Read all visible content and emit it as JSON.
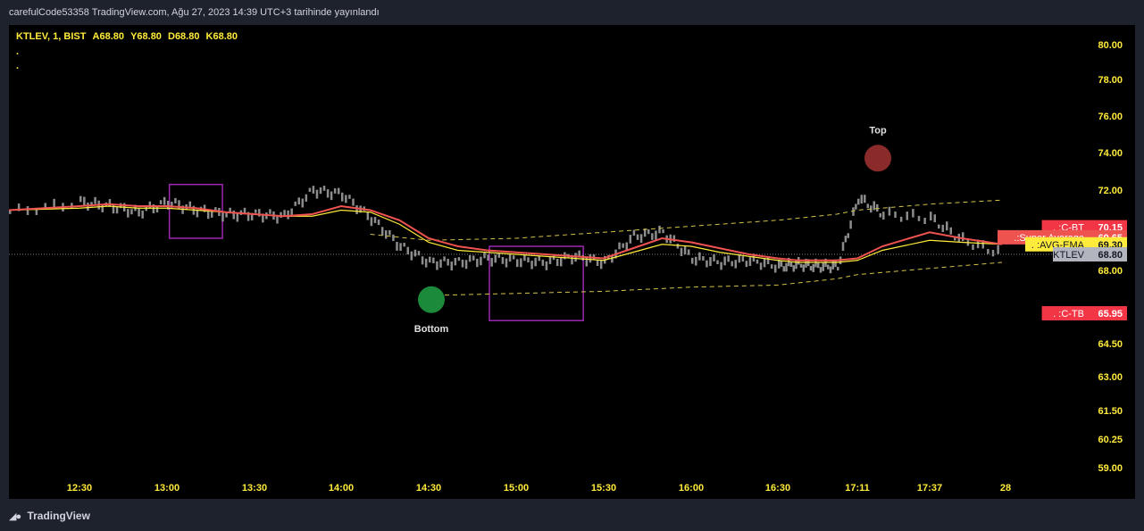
{
  "header": {
    "published": "carefulCode53358 TradingView.com, Ağu 27, 2023 14:39 UTC+3 tarihinde yayınlandı"
  },
  "legend": {
    "symbol": "KTLEV, 1, BIST",
    "open": "A68.80",
    "high": "Y68.80",
    "low": "D68.80",
    "close": "K68.80",
    "dots": [
      ".",
      "."
    ]
  },
  "footer": {
    "brand": "TradingView",
    "logo_icon": "tradingview-logo-icon"
  },
  "colors": {
    "background": "#000000",
    "frame": "#1e222d",
    "axis_text": "#ffeb3b",
    "candle": "#8c8c8c",
    "super_average": "#ef5350",
    "avg_ema": "#ffeb3b",
    "channel": "#d4c34a",
    "bottom_marker": "#1b8a3a",
    "top_marker": "#8b2a2a",
    "highlight_box": "#9c27b0",
    "sell_triangle": "#ef5350",
    "buy_triangle": "#ffeb3b",
    "buy_triangle_alt": "#26a6d1"
  },
  "chart_data": {
    "type": "line",
    "title": "",
    "y_axis": {
      "position": "right",
      "ticks": [
        80.0,
        78.0,
        76.0,
        74.0,
        72.0,
        70.15,
        69.65,
        69.3,
        68.8,
        68.0,
        65.95,
        64.5,
        63.0,
        61.5,
        60.25,
        59.0
      ],
      "tick_labels": [
        "80.00",
        "78.00",
        "76.00",
        "74.00",
        "72.00",
        "68.00",
        "64.50",
        "63.00",
        "61.50",
        "60.25",
        "59.00"
      ]
    },
    "x_axis": {
      "tick_labels": [
        "12:30",
        "13:00",
        "13:30",
        "14:00",
        "14:30",
        "15:00",
        "15:30",
        "16:00",
        "16:30",
        "17:11",
        "17:37",
        "28"
      ]
    },
    "grid": false,
    "price_labels": [
      {
        "name": ". :C-BT",
        "value": "70.15",
        "color": "#f23645"
      },
      {
        "name": ".:Super Avarage",
        "value": "69.65",
        "color": "#ef5350"
      },
      {
        "name": ". :AVG-EMA",
        "value": "69.30",
        "color": "#ffeb3b"
      },
      {
        "name": "KTLEV",
        "value": "68.80",
        "color": "#b2b5be"
      },
      {
        "name": ". :C-TB",
        "value": "65.95",
        "color": "#f23645"
      }
    ],
    "annotations": [
      {
        "text": "Top",
        "time": "17:11",
        "value": 73.7
      },
      {
        "text": "Bottom",
        "time": "14:30",
        "value": 66.6
      }
    ],
    "series": [
      {
        "name": ".:Super Avarage",
        "time": [
          "12:20",
          "12:30",
          "12:40",
          "12:50",
          "13:00",
          "13:10",
          "13:20",
          "13:30",
          "13:40",
          "13:50",
          "14:00",
          "14:10",
          "14:20",
          "14:30",
          "14:40",
          "14:50",
          "15:00",
          "15:10",
          "15:20",
          "15:30",
          "15:40",
          "15:50",
          "16:00",
          "16:10",
          "16:20",
          "16:30",
          "16:40",
          "16:50",
          "17:00",
          "17:11",
          "17:20",
          "17:37",
          "17:45",
          "17:55"
        ],
        "values": [
          71.0,
          71.2,
          71.3,
          71.2,
          71.2,
          71.1,
          70.9,
          70.8,
          70.7,
          70.8,
          71.2,
          71.0,
          70.5,
          69.6,
          69.2,
          69.0,
          68.9,
          68.8,
          68.7,
          68.6,
          69.1,
          69.6,
          69.4,
          69.1,
          68.8,
          68.6,
          68.5,
          68.5,
          68.5,
          68.6,
          69.2,
          69.9,
          69.6,
          69.3
        ]
      },
      {
        "name": ". :AVG-EMA",
        "time": [
          "12:20",
          "12:30",
          "12:40",
          "12:50",
          "13:00",
          "13:10",
          "13:20",
          "13:30",
          "13:40",
          "13:50",
          "14:00",
          "14:10",
          "14:20",
          "14:30",
          "14:40",
          "14:50",
          "15:00",
          "15:10",
          "15:20",
          "15:30",
          "15:40",
          "15:50",
          "16:00",
          "16:10",
          "16:20",
          "16:30",
          "16:40",
          "16:50",
          "17:00",
          "17:11",
          "17:20",
          "17:37",
          "17:45",
          "17:55"
        ],
        "values": [
          71.0,
          71.1,
          71.2,
          71.1,
          71.1,
          71.0,
          70.9,
          70.8,
          70.7,
          70.7,
          71.0,
          70.9,
          70.3,
          69.4,
          69.0,
          68.9,
          68.8,
          68.7,
          68.6,
          68.5,
          68.9,
          69.3,
          69.2,
          68.9,
          68.7,
          68.5,
          68.4,
          68.4,
          68.4,
          68.5,
          69.0,
          69.5,
          69.4,
          69.3
        ]
      },
      {
        "name": "KTLEV",
        "time": [
          "12:20",
          "12:30",
          "12:40",
          "12:50",
          "13:00",
          "13:10",
          "13:20",
          "13:30",
          "13:40",
          "13:50",
          "14:00",
          "14:10",
          "14:20",
          "14:30",
          "14:40",
          "14:50",
          "15:00",
          "15:10",
          "15:20",
          "15:30",
          "15:40",
          "15:50",
          "16:00",
          "16:10",
          "16:20",
          "16:30",
          "16:40",
          "16:50",
          "17:00",
          "17:11",
          "17:20",
          "17:37",
          "17:45",
          "17:55"
        ],
        "values": [
          70.9,
          71.4,
          71.2,
          70.9,
          71.4,
          71.0,
          70.8,
          70.8,
          70.7,
          72.0,
          71.8,
          70.6,
          69.2,
          68.4,
          68.4,
          68.6,
          68.5,
          68.4,
          68.7,
          68.4,
          69.7,
          69.9,
          68.6,
          68.4,
          68.5,
          68.2,
          68.3,
          68.2,
          68.2,
          71.6,
          70.8,
          70.6,
          69.5,
          68.8
        ]
      },
      {
        "name": "",
        "time": [
          "14:10",
          "14:30",
          "15:00",
          "15:30",
          "16:00",
          "16:30",
          "17:00",
          "17:11",
          "17:37",
          "17:55"
        ],
        "values": [
          69.8,
          69.5,
          69.6,
          69.9,
          70.2,
          70.5,
          70.8,
          71.0,
          71.3,
          71.5
        ]
      },
      {
        "name": "",
        "time": [
          "14:30",
          "15:00",
          "15:30",
          "16:00",
          "16:30",
          "17:00",
          "17:11",
          "17:37",
          "17:55"
        ],
        "values": [
          66.8,
          66.9,
          67.0,
          67.2,
          67.3,
          67.6,
          67.8,
          68.1,
          68.4
        ]
      }
    ]
  }
}
